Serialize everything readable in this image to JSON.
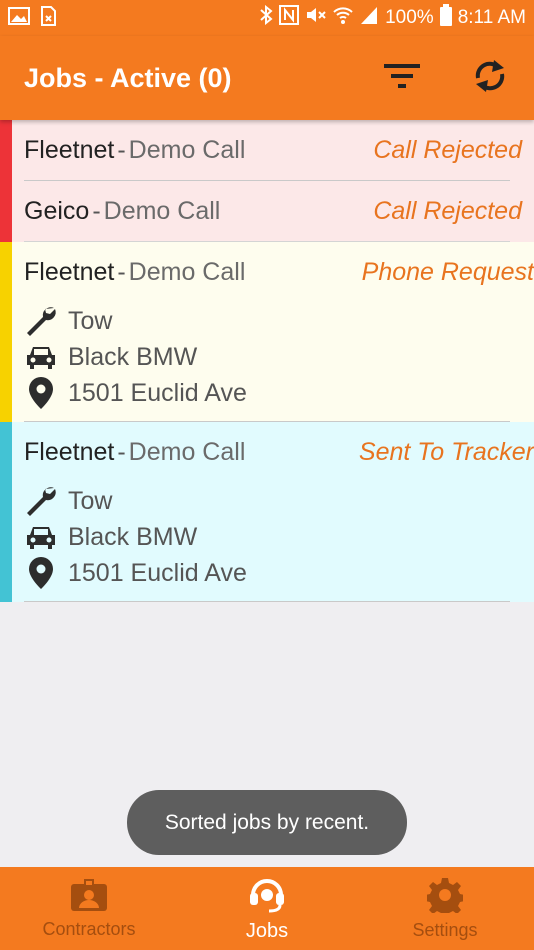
{
  "status_bar": {
    "battery": "100%",
    "time": "8:11 AM"
  },
  "app_bar": {
    "title": "Jobs - Active (0)",
    "icons": [
      "filter-icon",
      "refresh-icon"
    ]
  },
  "jobs": [
    {
      "company": "Fleetnet",
      "separator": "-",
      "call_type": "Demo Call",
      "status": "Call Rejected",
      "state": "rejected"
    },
    {
      "company": "Geico",
      "separator": "-",
      "call_type": "Demo Call",
      "status": "Call Rejected",
      "state": "rejected"
    },
    {
      "company": "Fleetnet",
      "separator": "-",
      "call_type": "Demo Call",
      "status": "Phone Request",
      "state": "phone",
      "service": "Tow",
      "vehicle": "Black BMW",
      "address": "1501 Euclid Ave"
    },
    {
      "company": "Fleetnet",
      "separator": "-",
      "call_type": "Demo Call",
      "status": "Sent To Tracker",
      "state": "tracker",
      "service": "Tow",
      "vehicle": "Black BMW",
      "address": "1501 Euclid Ave"
    }
  ],
  "colors": {
    "accent": "#f47a1f",
    "rejected": "#ed3338",
    "phone": "#f7d200",
    "tracker": "#43c3d4",
    "status_text": "#e8741f"
  },
  "toast": {
    "message": "Sorted jobs by recent."
  },
  "bottom_nav": {
    "items": [
      {
        "label": "Contractors",
        "icon": "contractor-badge-icon",
        "active": false
      },
      {
        "label": "Jobs",
        "icon": "headset-icon",
        "active": true
      },
      {
        "label": "Settings",
        "icon": "gear-icon",
        "active": false
      }
    ]
  }
}
